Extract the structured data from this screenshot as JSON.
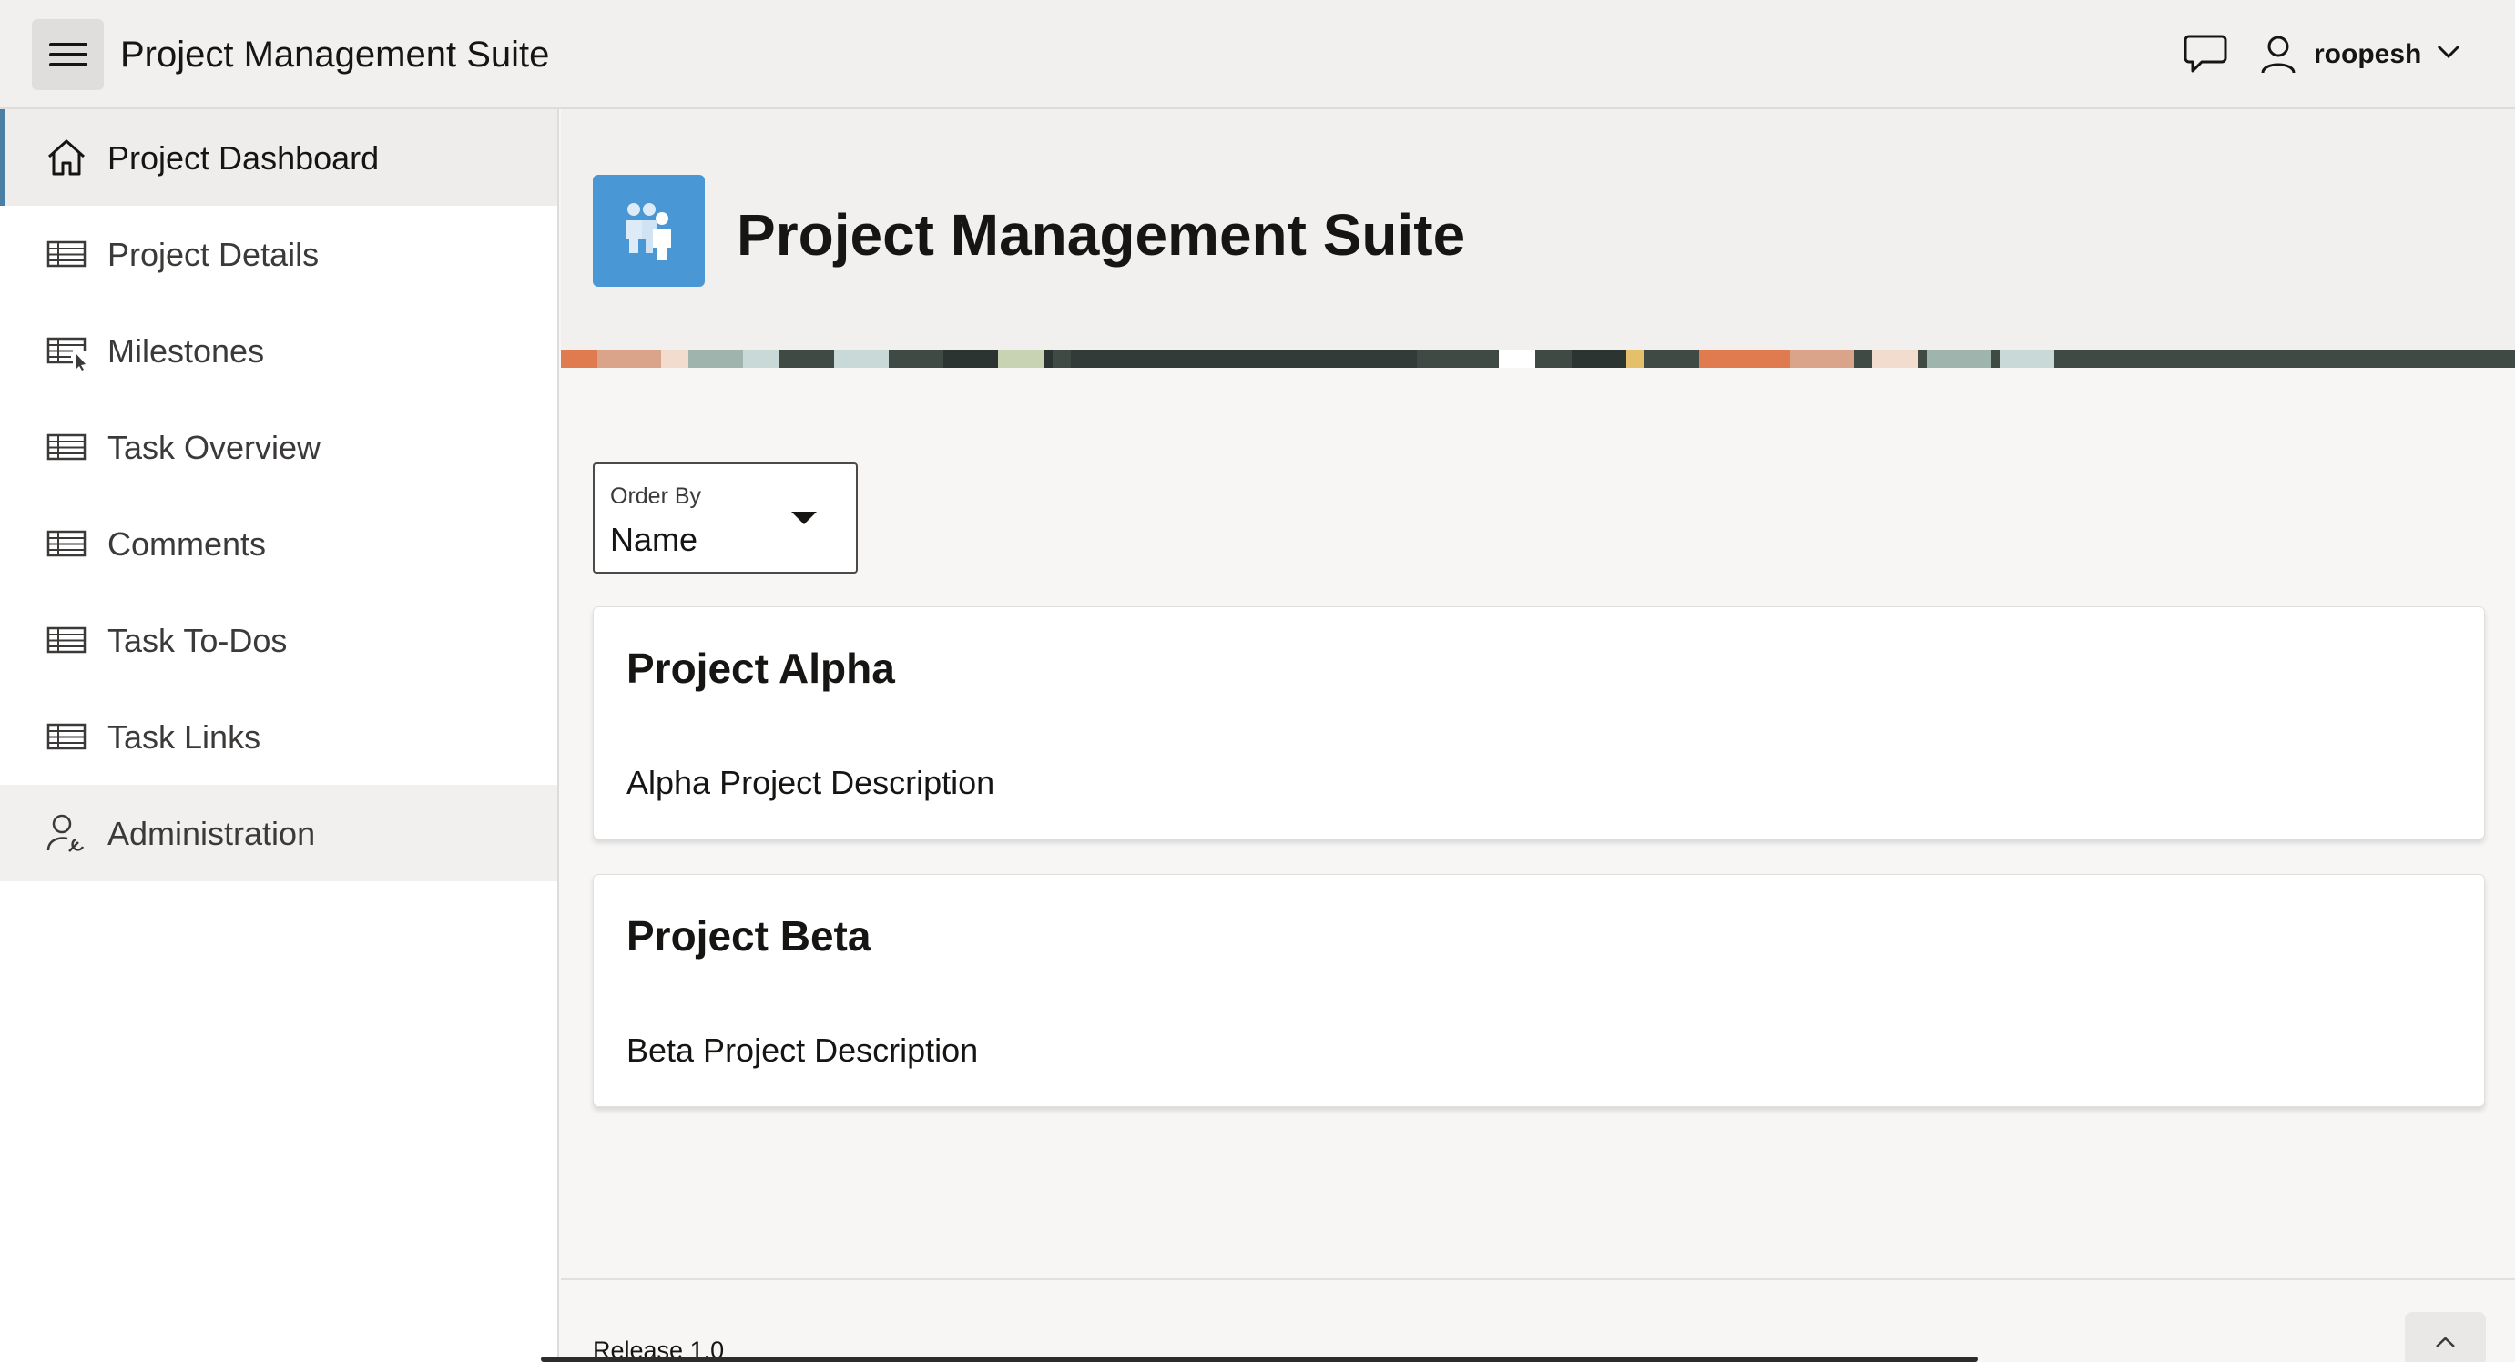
{
  "header": {
    "app_title": "Project Management Suite",
    "user_name": "roopesh",
    "icons": [
      "hamburger-menu-icon",
      "chat-icon",
      "user-icon",
      "chevron-down-icon"
    ]
  },
  "sidebar": {
    "items": [
      {
        "label": "Project Dashboard",
        "icon": "home-icon",
        "state": "active"
      },
      {
        "label": "Project Details",
        "icon": "table-icon"
      },
      {
        "label": "Milestones",
        "icon": "table-cursor-icon"
      },
      {
        "label": "Task Overview",
        "icon": "table-icon"
      },
      {
        "label": "Comments",
        "icon": "table-icon"
      },
      {
        "label": "Task To-Dos",
        "icon": "table-icon"
      },
      {
        "label": "Task Links",
        "icon": "table-icon"
      },
      {
        "label": "Administration",
        "icon": "user-wrench-icon",
        "state": "expanded"
      }
    ]
  },
  "hero": {
    "title": "Project Management Suite",
    "icon": "team-icon",
    "icon_color": "#4a97d6"
  },
  "order_by": {
    "label": "Order By",
    "value": "Name"
  },
  "projects": [
    {
      "title": "Project Alpha",
      "description": "Alpha Project Description"
    },
    {
      "title": "Project Beta",
      "description": "Beta Project Description"
    }
  ],
  "footer": {
    "release": "Release 1.0"
  },
  "colors": {
    "accent": "#4a7fa3",
    "header_bg": "#f1f0ef",
    "page_bg": "#f7f6f5"
  }
}
